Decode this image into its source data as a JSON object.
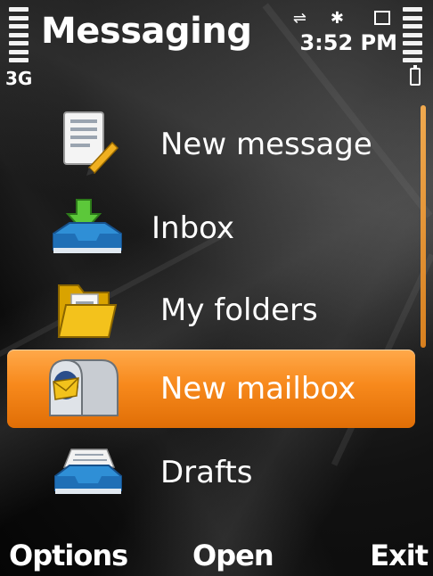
{
  "header": {
    "title": "Messaging",
    "network": "3G",
    "time": "3:52 PM"
  },
  "menu": {
    "items": [
      {
        "label": "New message",
        "icon": "new-message-icon"
      },
      {
        "label": "Inbox",
        "icon": "inbox-icon"
      },
      {
        "label": "My folders",
        "icon": "folder-icon"
      },
      {
        "label": "New mailbox",
        "icon": "mailbox-icon",
        "selected": true
      },
      {
        "label": "Drafts",
        "icon": "drafts-icon"
      }
    ]
  },
  "softkeys": {
    "left": "Options",
    "center": "Open",
    "right": "Exit"
  },
  "colors": {
    "accent": "#f7891c",
    "background": "#000000"
  }
}
